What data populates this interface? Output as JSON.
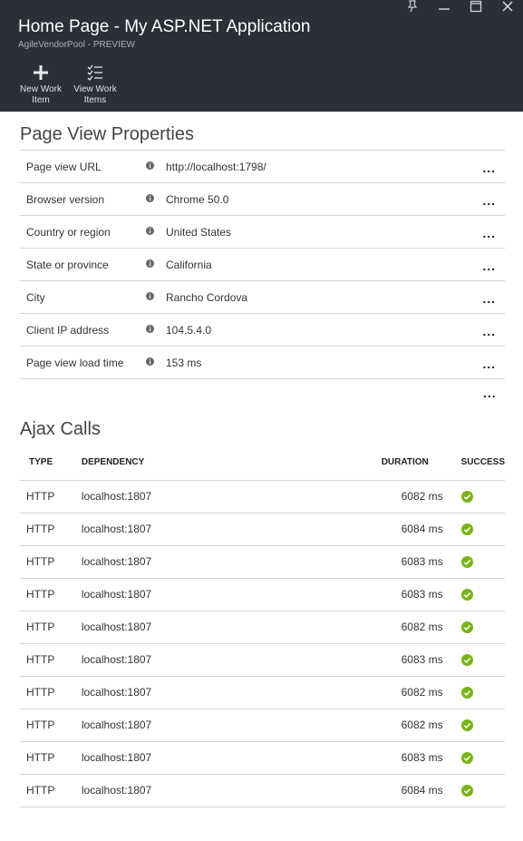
{
  "window": {
    "title": "Home Page - My ASP.NET Application",
    "subtitle": "AgileVendorPool - PREVIEW",
    "controls": [
      "pin-icon",
      "minimize-icon",
      "maximize-icon",
      "close-icon"
    ]
  },
  "commands": [
    {
      "label_line1": "New Work",
      "label_line2": "Item",
      "icon": "plus-icon"
    },
    {
      "label_line1": "View Work",
      "label_line2": "Items",
      "icon": "checklist-icon"
    }
  ],
  "page_view": {
    "title": "Page View Properties",
    "rows": [
      {
        "name": "Page view URL",
        "value": "http://localhost:1798/"
      },
      {
        "name": "Browser version",
        "value": "Chrome 50.0"
      },
      {
        "name": "Country or region",
        "value": "United States"
      },
      {
        "name": "State or province",
        "value": "California"
      },
      {
        "name": "City",
        "value": "Rancho Cordova"
      },
      {
        "name": "Client IP address",
        "value": "104.5.4.0"
      },
      {
        "name": "Page view load time",
        "value": "153 ms"
      }
    ],
    "more": "..."
  },
  "ajax": {
    "title": "Ajax Calls",
    "headers": {
      "type": "TYPE",
      "dependency": "DEPENDENCY",
      "duration": "DURATION",
      "success": "SUCCESS"
    },
    "rows": [
      {
        "type": "HTTP",
        "dependency": "localhost:1807",
        "duration": "6082 ms",
        "success": true
      },
      {
        "type": "HTTP",
        "dependency": "localhost:1807",
        "duration": "6084 ms",
        "success": true
      },
      {
        "type": "HTTP",
        "dependency": "localhost:1807",
        "duration": "6083 ms",
        "success": true
      },
      {
        "type": "HTTP",
        "dependency": "localhost:1807",
        "duration": "6083 ms",
        "success": true
      },
      {
        "type": "HTTP",
        "dependency": "localhost:1807",
        "duration": "6082 ms",
        "success": true
      },
      {
        "type": "HTTP",
        "dependency": "localhost:1807",
        "duration": "6083 ms",
        "success": true
      },
      {
        "type": "HTTP",
        "dependency": "localhost:1807",
        "duration": "6082 ms",
        "success": true
      },
      {
        "type": "HTTP",
        "dependency": "localhost:1807",
        "duration": "6082 ms",
        "success": true
      },
      {
        "type": "HTTP",
        "dependency": "localhost:1807",
        "duration": "6083 ms",
        "success": true
      },
      {
        "type": "HTTP",
        "dependency": "localhost:1807",
        "duration": "6084 ms",
        "success": true
      }
    ]
  },
  "colors": {
    "header_bg": "#2b3036",
    "success": "#7ab317",
    "divider": "#d4d4d4"
  }
}
